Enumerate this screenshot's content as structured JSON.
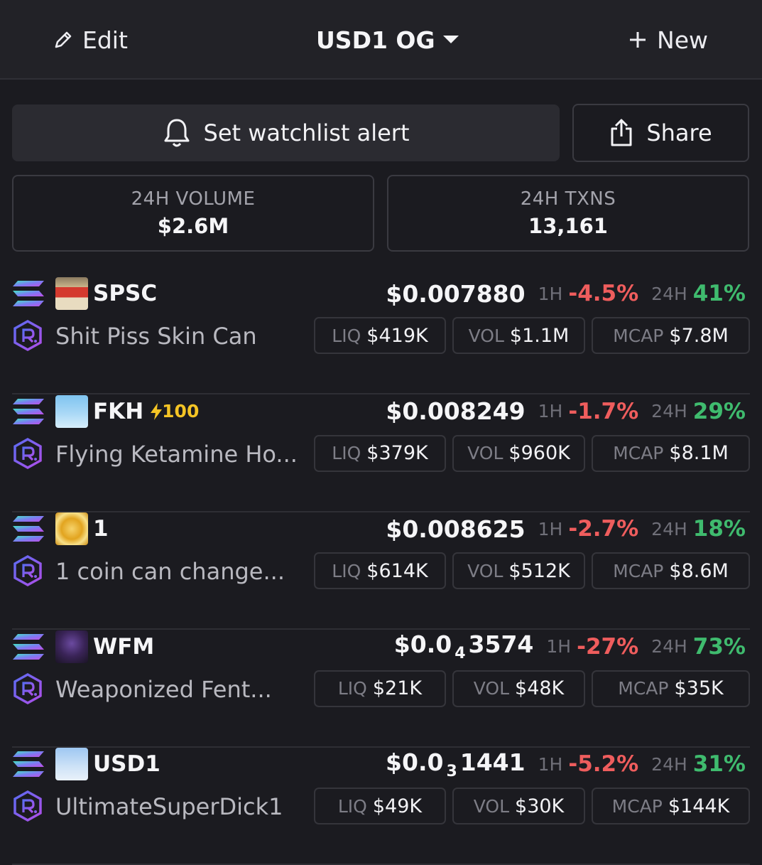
{
  "header": {
    "edit_label": "Edit",
    "title": "USD1 OG",
    "new_label": "New"
  },
  "actions": {
    "alert_label": "Set watchlist alert",
    "share_label": "Share"
  },
  "stats": {
    "volume_label": "24H VOLUME",
    "volume_value": "$2.6M",
    "txns_label": "24H TXNS",
    "txns_value": "13,161"
  },
  "labels": {
    "h1": "1H",
    "h24": "24H",
    "liq": "LIQ",
    "vol": "VOL",
    "mcap": "MCAP"
  },
  "tokens": [
    {
      "symbol": "SPSC",
      "name": "Shit Piss Skin Can",
      "price_main": "$0.007880",
      "price_sub": "",
      "price_tail": "",
      "change_1h": "-4.5%",
      "change_24h": "41%",
      "liq": "$419K",
      "vol": "$1.1M",
      "mcap": "$7.8M",
      "boost": ""
    },
    {
      "symbol": "FKH",
      "name": "Flying Ketamine Ho...",
      "price_main": "$0.008249",
      "price_sub": "",
      "price_tail": "",
      "change_1h": "-1.7%",
      "change_24h": "29%",
      "liq": "$379K",
      "vol": "$960K",
      "mcap": "$8.1M",
      "boost": "100"
    },
    {
      "symbol": "1",
      "name": "1 coin can change...",
      "price_main": "$0.008625",
      "price_sub": "",
      "price_tail": "",
      "change_1h": "-2.7%",
      "change_24h": "18%",
      "liq": "$614K",
      "vol": "$512K",
      "mcap": "$8.6M",
      "boost": ""
    },
    {
      "symbol": "WFM",
      "name": "Weaponized Fent...",
      "price_main": "$0.0",
      "price_sub": "4",
      "price_tail": "3574",
      "change_1h": "-27%",
      "change_24h": "73%",
      "liq": "$21K",
      "vol": "$48K",
      "mcap": "$35K",
      "boost": ""
    },
    {
      "symbol": "USD1",
      "name": "UltimateSuperDick1",
      "price_main": "$0.0",
      "price_sub": "3",
      "price_tail": "1441",
      "change_1h": "-5.2%",
      "change_24h": "31%",
      "liq": "$49K",
      "vol": "$30K",
      "mcap": "$144K",
      "boost": ""
    }
  ],
  "colors": {
    "positive": "#3fbb6e",
    "negative": "#ef5d5d",
    "boost": "#f4c425",
    "background": "#1b1b20"
  }
}
